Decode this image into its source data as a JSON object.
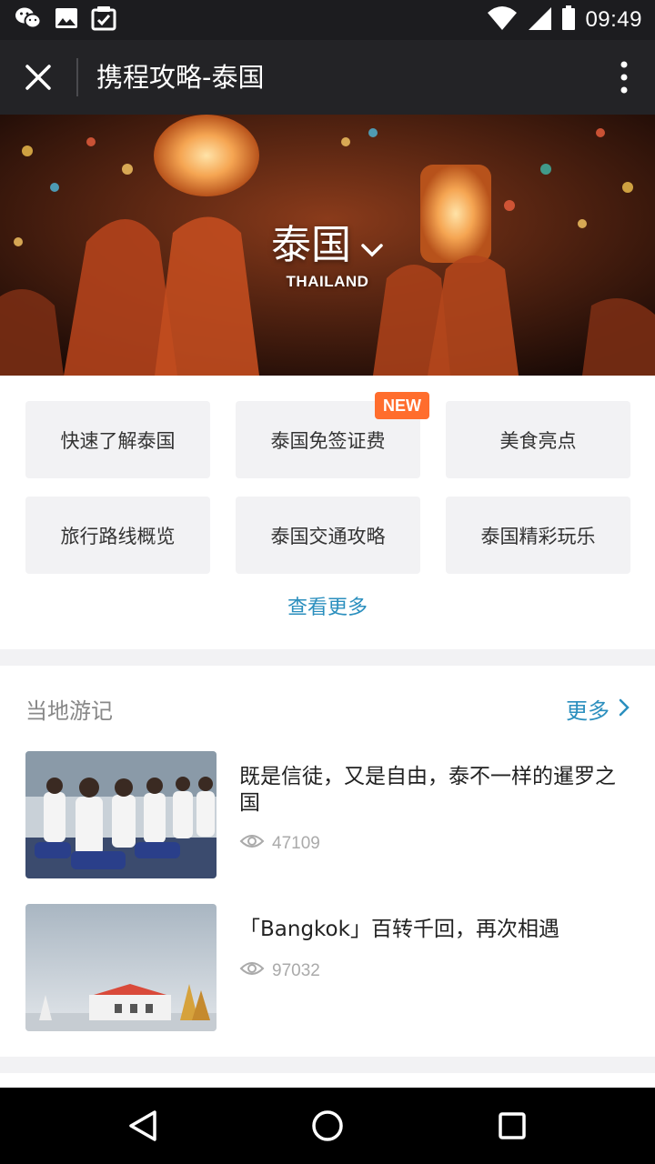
{
  "status_bar": {
    "time": "09:49",
    "left_icons": [
      "wechat-icon",
      "image-icon",
      "checklist-icon"
    ],
    "right_icons": [
      "wifi-icon",
      "signal-icon",
      "battery-icon"
    ]
  },
  "title_bar": {
    "title": "携程攻略-泰国",
    "close_icon": "close-icon",
    "more_icon": "more-vertical-icon"
  },
  "hero": {
    "name": "泰国",
    "subtitle": "THAILAND",
    "dropdown_icon": "chevron-down-icon"
  },
  "quick_links": [
    {
      "label": "快速了解泰国",
      "badge": ""
    },
    {
      "label": "泰国免签证费",
      "badge": "NEW"
    },
    {
      "label": "美食亮点",
      "badge": ""
    },
    {
      "label": "旅行路线概览",
      "badge": ""
    },
    {
      "label": "泰国交通攻略",
      "badge": ""
    },
    {
      "label": "泰国精彩玩乐",
      "badge": ""
    }
  ],
  "see_more": "查看更多",
  "travelogues": {
    "title": "当地游记",
    "more": "更多",
    "items": [
      {
        "title": "既是信徒，又是自由，泰不一样的暹罗之国",
        "views": "47109",
        "thumb": "students-praying-photo"
      },
      {
        "title": "「Bangkok」百转千回，再次相遇",
        "views": "97032",
        "thumb": "bangkok-palace-photo"
      }
    ]
  },
  "colors": {
    "accent": "#2b8fbe",
    "badge": "#ff6d2d",
    "tile_bg": "#f2f2f4",
    "titlebar_bg": "#232326"
  },
  "nav_bar": {
    "icons": [
      "back-icon",
      "home-icon",
      "recents-icon"
    ]
  }
}
